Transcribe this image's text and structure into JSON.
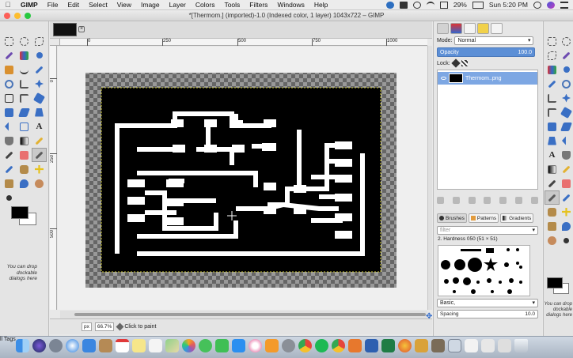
{
  "menubar": {
    "app_name": "GIMP",
    "items": [
      "File",
      "Edit",
      "Select",
      "View",
      "Image",
      "Layer",
      "Colors",
      "Tools",
      "Filters",
      "Windows",
      "Help"
    ],
    "battery": "29%",
    "clock": "Sun 5:20 PM"
  },
  "window": {
    "title": "*[Thermom.] (imported)-1.0 (Indexed color, 1 layer) 1043x722 – GIMP"
  },
  "rulers": {
    "h_labels": [
      "0",
      "250",
      "500",
      "750",
      "1000"
    ],
    "v_labels": [
      "0",
      "250",
      "500"
    ]
  },
  "statusbar": {
    "unit": "px",
    "zoom": "66.7%",
    "message": "Click to paint"
  },
  "toolbox": {
    "drop_hint": "You can drop dockable dialogs here"
  },
  "toolbox2": {
    "drop_hint": "You can drop dockable dialogs here"
  },
  "layers": {
    "mode_label": "Mode:",
    "mode_value": "Normal",
    "opacity_label": "Opacity",
    "opacity_value": "100.0",
    "lock_label": "Lock:",
    "layer_name": "Thermom..png"
  },
  "brushes": {
    "tabs": [
      "Brushes",
      "Patterns",
      "Gradients"
    ],
    "filter_placeholder": "filter",
    "current_brush": "2. Hardness 050 (51 × 51)",
    "preset": "Basic,",
    "spacing_label": "Spacing",
    "spacing_value": "10.0"
  },
  "macdock": {
    "left_label": "ll Tags"
  }
}
